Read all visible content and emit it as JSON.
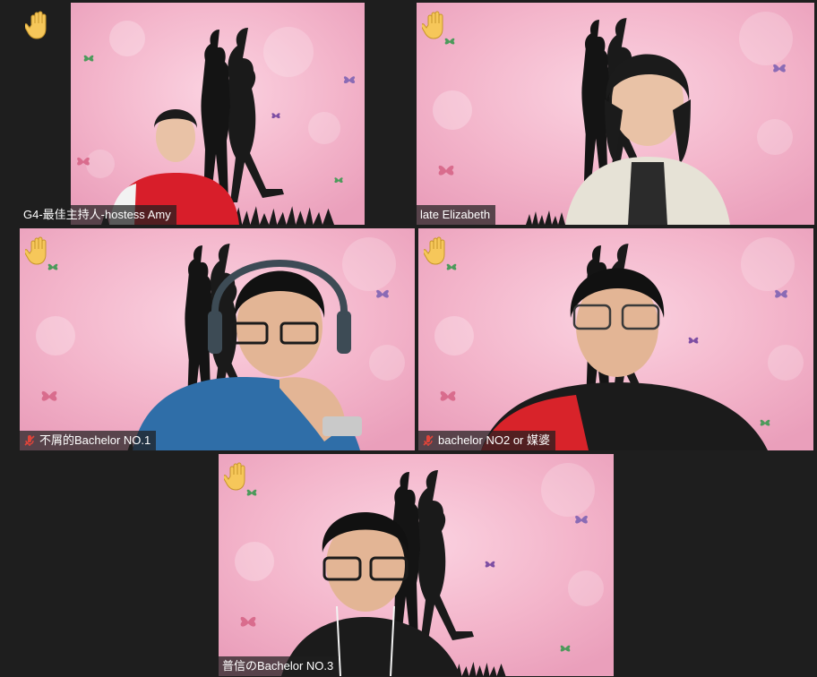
{
  "meeting": {
    "participants": [
      {
        "name": "G4-最佳主持人-hostess Amy",
        "muted": false,
        "hand_raised": true,
        "active_speaker": false
      },
      {
        "name": "late Elizabeth",
        "muted": false,
        "hand_raised": true,
        "active_speaker": true
      },
      {
        "name": "不屑的Bachelor NO.1",
        "muted": true,
        "hand_raised": true,
        "active_speaker": false
      },
      {
        "name": "bachelor NO2 or 媒婆",
        "muted": true,
        "hand_raised": true,
        "active_speaker": false
      },
      {
        "name": "普信のBachelor NO.3",
        "muted": false,
        "hand_raised": true,
        "active_speaker": false
      }
    ]
  },
  "colors": {
    "background": "#1e1e1e",
    "active_border": "#c8e65c",
    "virtual_bg_pink": "#f2b3c9",
    "mute_icon": "#e0443a"
  },
  "icons": {
    "raise_hand": "raised-hand-icon",
    "muted_mic": "mic-muted-icon"
  }
}
